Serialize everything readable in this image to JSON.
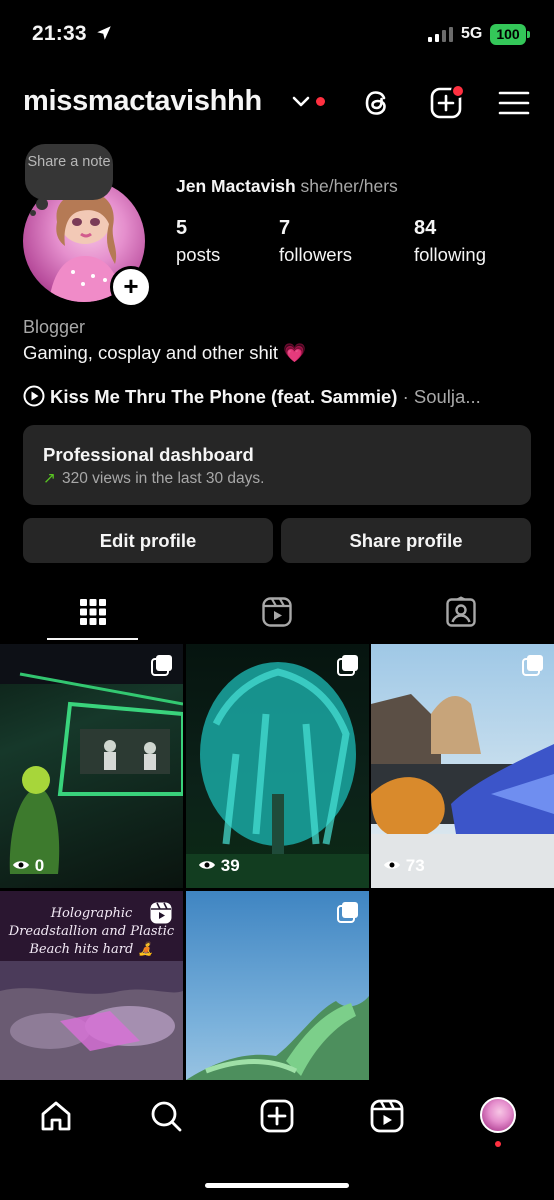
{
  "status_bar": {
    "time": "21:33",
    "network": "5G",
    "battery": "100"
  },
  "header": {
    "username": "missmactavishhh"
  },
  "profile": {
    "note_bubble": "Share a note",
    "full_name": "Jen Mactavish",
    "pronouns": "she/her/hers",
    "stats": [
      {
        "value": "5",
        "label": "posts"
      },
      {
        "value": "7",
        "label": "followers"
      },
      {
        "value": "84",
        "label": "following"
      }
    ],
    "category": "Blogger",
    "bio": "Gaming, cosplay and other shit 💗",
    "music_title": "Kiss Me Thru The Phone (feat. Sammie)",
    "music_artist": " · Soulja..."
  },
  "dashboard": {
    "title": "Professional dashboard",
    "subtitle": "320 views in the last 30 days.",
    "arrow": "↗"
  },
  "buttons": {
    "edit": "Edit profile",
    "share": "Share profile"
  },
  "tabs": [
    "grid",
    "reels",
    "tagged"
  ],
  "posts": [
    {
      "views": "0",
      "type": "carousel"
    },
    {
      "views": "39",
      "type": "carousel"
    },
    {
      "views": "73",
      "type": "carousel"
    },
    {
      "caption": "Holographic Dreadstallion and Plastic Beach hits hard 🧘",
      "type": "reel"
    },
    {
      "type": "carousel"
    }
  ],
  "bottom_nav": [
    "home",
    "search",
    "create",
    "reels",
    "profile"
  ],
  "colors": {
    "accent_red": "#ff3040",
    "battery_green": "#34c759",
    "trend_green": "#58c322",
    "surface": "#262626"
  }
}
